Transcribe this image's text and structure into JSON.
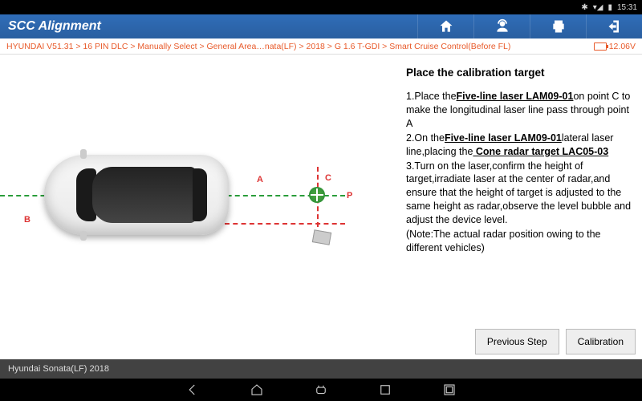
{
  "status": {
    "time": "15:31"
  },
  "header": {
    "title": "SCC Alignment"
  },
  "breadcrumb": {
    "path": "HYUNDAI V51.31 > 16 PIN DLC > Manually Select > General Area…nata(LF) > 2018 > G 1.6 T-GDI > Smart Cruise Control(Before FL)",
    "voltage": "12.06V"
  },
  "labels": {
    "A": "A",
    "B": "B",
    "C": "C",
    "P": "P"
  },
  "instructions": {
    "title": "Place the calibration target",
    "step1a": "1.Place the",
    "step1b": "Five-line laser LAM09-01",
    "step1c": "on point C to make the longitudinal laser line pass through point A",
    "step2a": "2.On the",
    "step2b": "Five-line laser LAM09-01",
    "step2c": "lateral laser line,placing the",
    "step2d": " Cone radar target LAC05-03",
    "step3": "3.Turn on the laser,confirm the height of target,irradiate laser at the center of radar,and ensure that the height of target is adjusted to the same height as radar,observe the level bubble and adjust the device level.",
    "note": "(Note:The actual radar position owing to the different vehicles)"
  },
  "buttons": {
    "prev": "Previous Step",
    "cal": "Calibration"
  },
  "footer": {
    "text": "Hyundai Sonata(LF) 2018"
  }
}
